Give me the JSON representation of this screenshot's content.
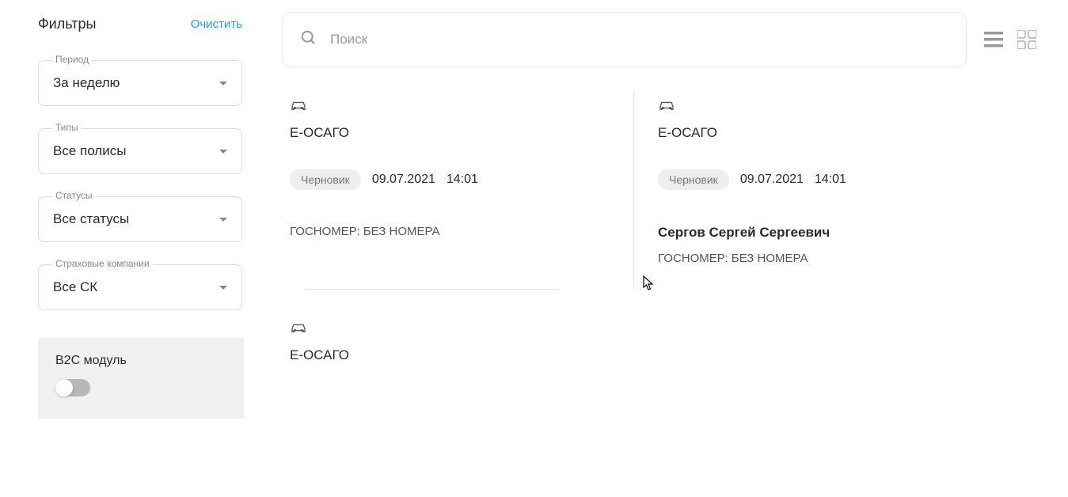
{
  "sidebar": {
    "title": "Фильтры",
    "clear_label": "Очистить",
    "filters": [
      {
        "label": "Период",
        "value": "За неделю"
      },
      {
        "label": "Типы",
        "value": "Все полисы"
      },
      {
        "label": "Статусы",
        "value": "Все статусы"
      },
      {
        "label": "Страховые компании",
        "value": "Все СК"
      }
    ],
    "b2c_label": "B2C модуль"
  },
  "search": {
    "placeholder": "Поиск"
  },
  "cards": [
    {
      "policy_type": "Е-ОСАГО",
      "status": "Черновик",
      "date": "09.07.2021",
      "time": "14:01",
      "client_name": "",
      "car_number": "ГОСНОМЕР: БЕЗ НОМЕРА"
    },
    {
      "policy_type": "Е-ОСАГО",
      "status": "Черновик",
      "date": "09.07.2021",
      "time": "14:01",
      "client_name": "Сергов Сергей Сергеевич",
      "car_number": "ГОСНОМЕР: БЕЗ НОМЕРА"
    },
    {
      "policy_type": "Е-ОСАГО",
      "status": "",
      "date": "",
      "time": "",
      "client_name": "",
      "car_number": ""
    }
  ]
}
